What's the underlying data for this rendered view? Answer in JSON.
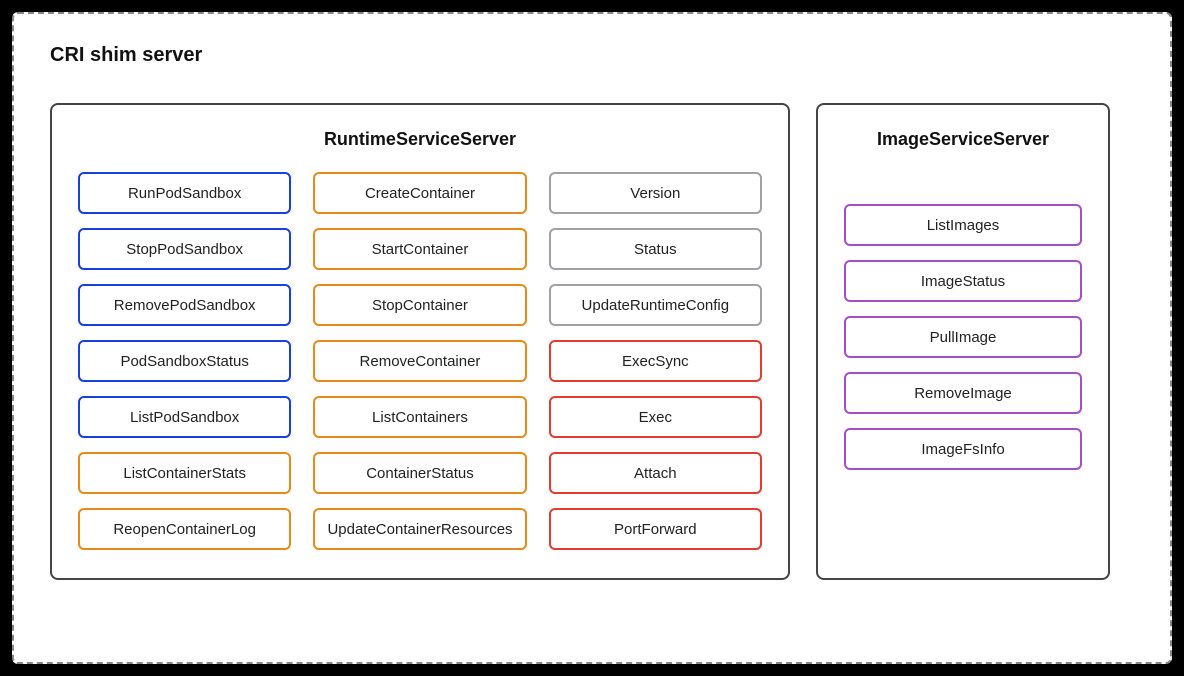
{
  "title": "CRI shim server",
  "colors": {
    "blue": "#1a3fe0",
    "orange": "#e88a1a",
    "gray": "#9ea1a6",
    "red": "#e23c2f",
    "purple": "#a44fc9"
  },
  "runtime": {
    "title": "RuntimeServiceServer",
    "col1": [
      {
        "label": "RunPodSandbox",
        "color": "blue"
      },
      {
        "label": "StopPodSandbox",
        "color": "blue"
      },
      {
        "label": "RemovePodSandbox",
        "color": "blue"
      },
      {
        "label": "PodSandboxStatus",
        "color": "blue"
      },
      {
        "label": "ListPodSandbox",
        "color": "blue"
      },
      {
        "label": "ListContainerStats",
        "color": "orange"
      },
      {
        "label": "ReopenContainerLog",
        "color": "orange"
      }
    ],
    "col2": [
      {
        "label": "CreateContainer",
        "color": "orange"
      },
      {
        "label": "StartContainer",
        "color": "orange"
      },
      {
        "label": "StopContainer",
        "color": "orange"
      },
      {
        "label": "RemoveContainer",
        "color": "orange"
      },
      {
        "label": "ListContainers",
        "color": "orange"
      },
      {
        "label": "ContainerStatus",
        "color": "orange"
      },
      {
        "label": "UpdateContainerResources",
        "color": "orange"
      }
    ],
    "col3": [
      {
        "label": "Version",
        "color": "gray"
      },
      {
        "label": "Status",
        "color": "gray"
      },
      {
        "label": "UpdateRuntimeConfig",
        "color": "gray"
      },
      {
        "label": "ExecSync",
        "color": "red"
      },
      {
        "label": "Exec",
        "color": "red"
      },
      {
        "label": "Attach",
        "color": "red"
      },
      {
        "label": "PortForward",
        "color": "red"
      }
    ]
  },
  "image": {
    "title": "ImageServiceServer",
    "items": [
      {
        "label": "ListImages",
        "color": "purple"
      },
      {
        "label": "ImageStatus",
        "color": "purple"
      },
      {
        "label": "PullImage",
        "color": "purple"
      },
      {
        "label": "RemoveImage",
        "color": "purple"
      },
      {
        "label": "ImageFsInfo",
        "color": "purple"
      }
    ]
  }
}
